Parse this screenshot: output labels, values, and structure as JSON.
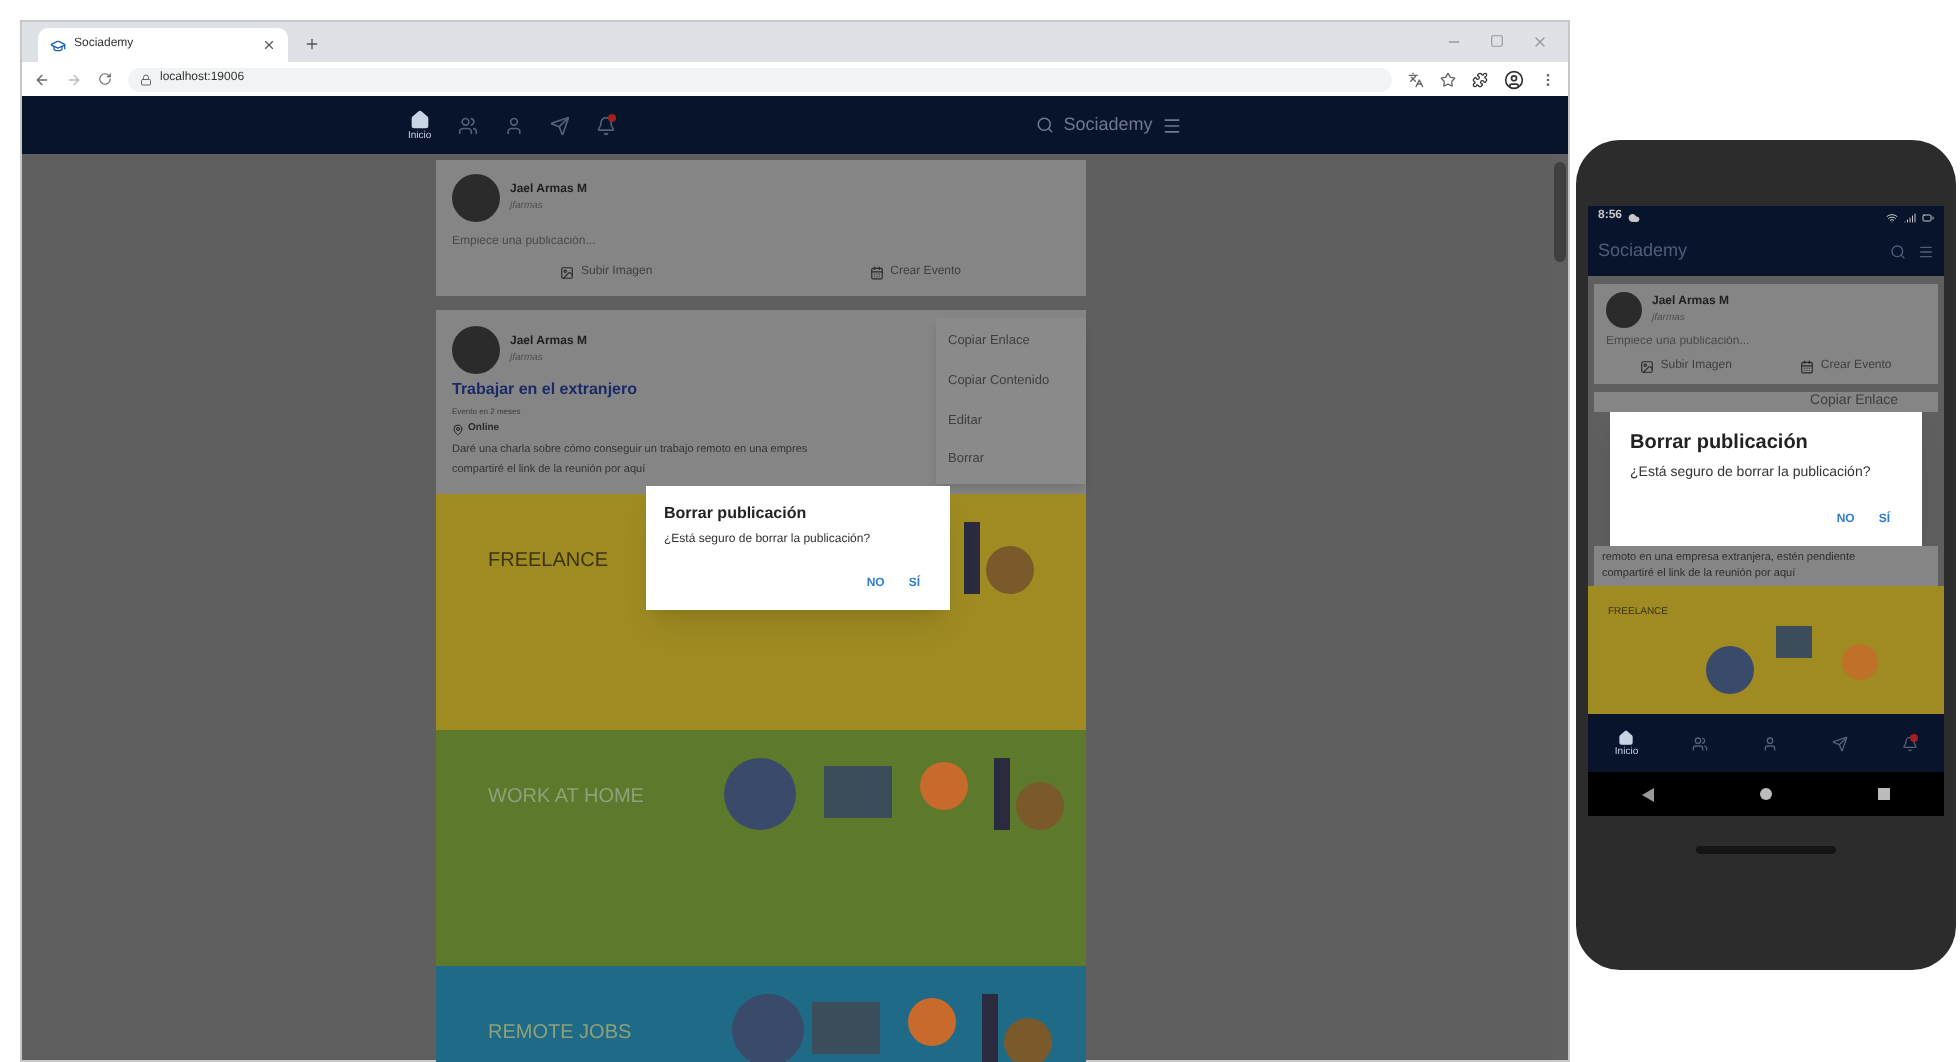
{
  "browser": {
    "tab_title": "Sociademy",
    "url": "localhost:19006"
  },
  "web": {
    "nav": [
      {
        "kind": "home",
        "label": "Inicio",
        "selected": true,
        "badge": false
      },
      {
        "kind": "group",
        "selected": false,
        "badge": false
      },
      {
        "kind": "person",
        "selected": false,
        "badge": false
      },
      {
        "kind": "send",
        "selected": false,
        "badge": false
      },
      {
        "kind": "bell",
        "selected": false,
        "badge": true
      }
    ],
    "brand": "Sociademy",
    "composer": {
      "author": "Jael Armas M",
      "handle": "jfarmas",
      "placeholder": "Empiece una publicación...",
      "actions": [
        {
          "kind": "image",
          "label": "Subir Imagen"
        },
        {
          "kind": "event",
          "label": "Crear Evento"
        }
      ]
    },
    "post": {
      "author": "Jael Armas M",
      "handle": "jfarmas",
      "title": "Trabajar en el extranjero",
      "subtitle": "Evento en 2 meses",
      "location": "Online",
      "body_lines": [
        "Daré una charla sobre cómo conseguir un trabajo remoto en una empres",
        "compartiré el link de la reunión por aquí"
      ]
    },
    "menu": [
      "Copiar Enlace",
      "Copiar Contenido",
      "Editar",
      "Borrar"
    ],
    "banners": [
      {
        "label": "FREELANCE",
        "color": "#a08b22"
      },
      {
        "label": "WORK AT HOME",
        "color": "#5d7a2c"
      },
      {
        "label": "REMOTE JOBS",
        "color": "#1f6a86"
      }
    ],
    "dialog": {
      "title": "Borrar publicación",
      "message": "¿Está seguro de borrar la publicación?",
      "buttons": [
        "NO",
        "SÍ"
      ]
    }
  },
  "phone": {
    "time": "8:56",
    "title": "Sociademy",
    "composer": {
      "author": "Jael Armas M",
      "handle": "jfarmas",
      "placeholder": "Empiece una publicación...",
      "actions": [
        {
          "kind": "image",
          "label": "Subir Imagen"
        },
        {
          "kind": "event",
          "label": "Crear Evento"
        }
      ]
    },
    "menu_peek": "Copiar Enlace",
    "dialog": {
      "title": "Borrar publicación",
      "message": "¿Está seguro de borrar la publicación?",
      "buttons": [
        "NO",
        "SÍ"
      ]
    },
    "body_lines": [
      "remoto en una empresa extranjera, estén pendiente",
      "compartiré el link de la reunión por aquí"
    ],
    "banner": {
      "label": "FREELANCE",
      "color": "#a08b22"
    },
    "nav": [
      {
        "kind": "home",
        "label": "Inicio",
        "selected": true,
        "badge": false
      },
      {
        "kind": "group",
        "selected": false,
        "badge": false
      },
      {
        "kind": "person",
        "selected": false,
        "badge": false
      },
      {
        "kind": "send",
        "selected": false,
        "badge": false
      },
      {
        "kind": "bell",
        "selected": false,
        "badge": true
      }
    ]
  }
}
